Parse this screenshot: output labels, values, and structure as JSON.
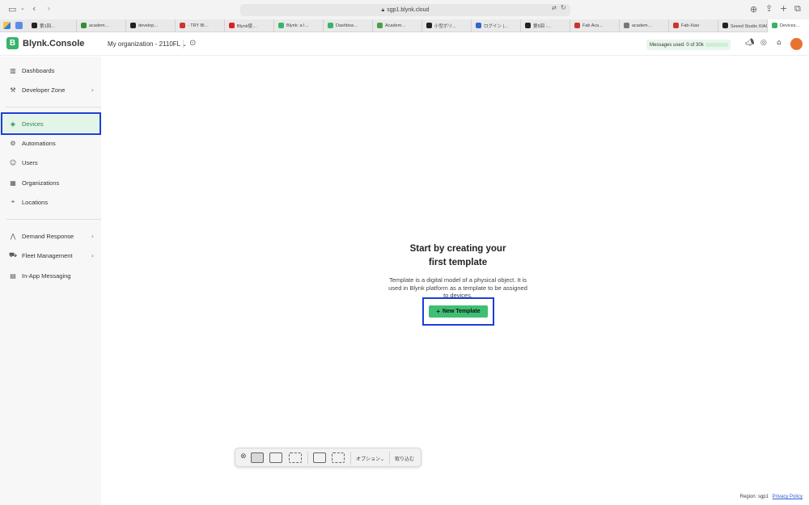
{
  "browser": {
    "url": "sgp1.blynk.cloud",
    "tabs": [
      {
        "label": "第1回…",
        "color": "#222222"
      },
      {
        "label": "academ…",
        "color": "#3a8a3a"
      },
      {
        "label": "develop…",
        "color": "#222222"
      },
      {
        "label": "- TRY Bl…",
        "color": "#cc3333"
      },
      {
        "label": "Blynk使…",
        "color": "#e02020"
      },
      {
        "label": "Blynk: a l…",
        "color": "#39b36b"
      },
      {
        "label": "Dashboa…",
        "color": "#39b36b"
      },
      {
        "label": "Academ…",
        "color": "#4aa04a"
      },
      {
        "label": "小型ボリ…",
        "color": "#222222"
      },
      {
        "label": "ログイン |…",
        "color": "#3366cc"
      },
      {
        "label": "第5回 -…",
        "color": "#222222"
      },
      {
        "label": "Fab Aca…",
        "color": "#cc3333"
      },
      {
        "label": "academ…",
        "color": "#777777"
      },
      {
        "label": "Fab-Xiao",
        "color": "#cc3333"
      },
      {
        "label": "Seeed Studio XIAO ラー…",
        "color": "#222222"
      },
      {
        "label": "Devices…",
        "color": "#39b36b"
      }
    ]
  },
  "header": {
    "logo_letter": "B",
    "logo_text": "Blynk.Console",
    "org_label": "My organization - 2110FL",
    "messages_label": "Messages used: 0 of 30k",
    "brand_color": "#39b36b"
  },
  "sidebar": {
    "items": [
      {
        "label": "Dashboards",
        "icon": "chart-icon"
      },
      {
        "label": "Developer Zone",
        "icon": "tools-icon"
      },
      {
        "label": "Devices",
        "icon": "cube-icon"
      },
      {
        "label": "Automations",
        "icon": "automation-icon"
      },
      {
        "label": "Users",
        "icon": "user-icon"
      },
      {
        "label": "Organizations",
        "icon": "building-icon"
      },
      {
        "label": "Locations",
        "icon": "pin-icon"
      },
      {
        "label": "Demand Response",
        "icon": "signal-icon"
      },
      {
        "label": "Fleet Management",
        "icon": "truck-icon"
      },
      {
        "label": "In-App Messaging",
        "icon": "message-icon"
      }
    ],
    "active": "Devices"
  },
  "main": {
    "title_line1": "Start by creating your",
    "title_line2": "first template",
    "description": "Template is a digital model of a physical object. It is used in Blynk platform as a template to be assigned to devices.",
    "new_template_label": "New Template"
  },
  "screenshot_bar": {
    "options_label": "オプション⌄",
    "capture_label": "取り込む"
  },
  "footer": {
    "region_label": "Region: sgp1",
    "privacy_label": "Privacy Policy"
  }
}
